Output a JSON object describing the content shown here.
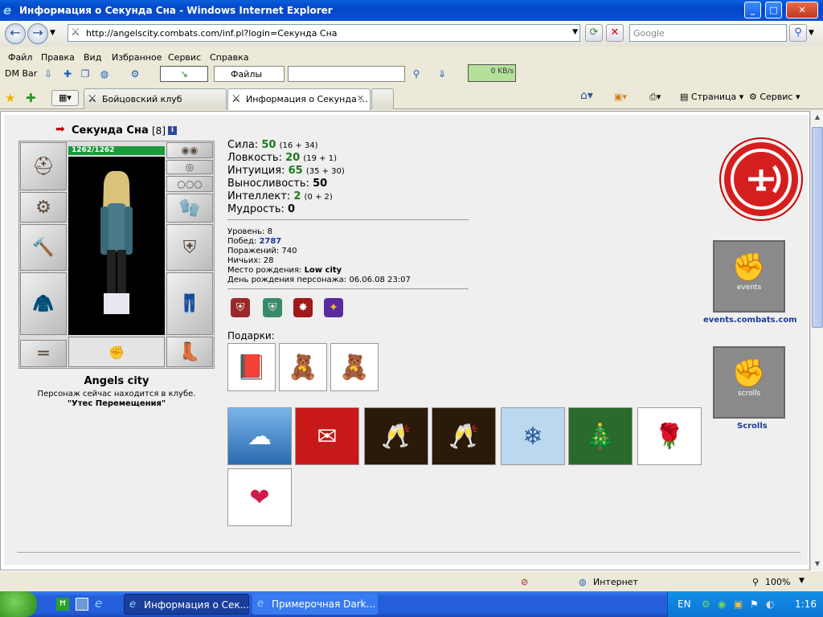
{
  "window": {
    "title": "Информация о Секунда Сна - Windows Internet Explorer"
  },
  "address": {
    "url": "http://angelscity.combats.com/inf.pl?login=Секунда Сна",
    "search_placeholder": "Google"
  },
  "menu": [
    "Файл",
    "Правка",
    "Вид",
    "Избранное",
    "Сервис",
    "Справка"
  ],
  "dmbar": {
    "label": "DM Bar",
    "files": "Файлы",
    "speed": "0 KB/s"
  },
  "tabs": [
    {
      "label": "Бойцовский клуб"
    },
    {
      "label": "Информация о Секунда ..."
    }
  ],
  "tabbar_right": {
    "page": "Страница",
    "service": "Сервис"
  },
  "character": {
    "name": "Секунда Сна",
    "level": "[8]",
    "info": "i",
    "hp": "1262/1262",
    "city": "Angels city",
    "location_text": "Персонаж сейчас находится в клубе.",
    "location_name": "\"Утес Перемещения\""
  },
  "stats": [
    {
      "label": "Сила:",
      "value": "50",
      "detail": "(16 + 34)",
      "accent": "#1a7a1a"
    },
    {
      "label": "Ловкость:",
      "value": "20",
      "detail": "(19 + 1)",
      "accent": "#1a7a1a"
    },
    {
      "label": "Интуиция:",
      "value": "65",
      "detail": "(35 + 30)",
      "accent": "#1a7a1a"
    },
    {
      "label": "Выносливость:",
      "value": "50",
      "detail": "",
      "accent": "#000000"
    },
    {
      "label": "Интеллект:",
      "value": "2",
      "detail": "(0 + 2)",
      "accent": "#1a7a1a"
    },
    {
      "label": "Мудрость:",
      "value": "0",
      "detail": "",
      "accent": "#000000"
    }
  ],
  "info": {
    "level_label": "Уровень:",
    "level": "8",
    "wins_label": "Побед:",
    "wins": "2787",
    "losses_label": "Поражений:",
    "losses": "740",
    "draws_label": "Ничьих:",
    "draws": "28",
    "birthplace_label": "Место рождения:",
    "birthplace": "Low city",
    "birthday_label": "День рождения персонажа:",
    "birthday": "06.06.08 23:07"
  },
  "gifts_label": "Подарки:",
  "links": {
    "events": "events.combats.com",
    "scrolls": "Scrolls",
    "events_banner": "events",
    "scrolls_banner": "scrolls"
  },
  "status": {
    "zone": "Интернет",
    "zoom": "100%"
  },
  "taskbar": {
    "tasks": [
      "Информация о Сек...",
      "Примерочная Dark..."
    ],
    "lang": "EN",
    "time": "1:16"
  }
}
